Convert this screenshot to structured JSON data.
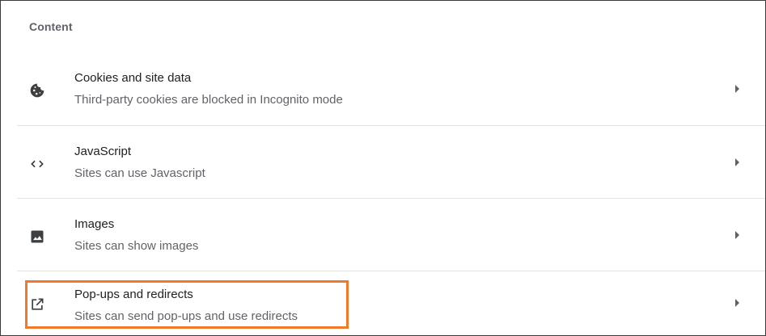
{
  "section": {
    "title": "Content"
  },
  "items": [
    {
      "icon": "cookie-icon",
      "label": "Cookies and site data",
      "description": "Third-party cookies are blocked in Incognito mode"
    },
    {
      "icon": "code-icon",
      "label": "JavaScript",
      "description": "Sites can use Javascript"
    },
    {
      "icon": "image-icon",
      "label": "Images",
      "description": "Sites can show images"
    },
    {
      "icon": "open-in-new-icon",
      "label": "Pop-ups and redirects",
      "description": "Sites can send pop-ups and use redirects"
    }
  ],
  "colors": {
    "highlight": "#f07a2a",
    "primary_text": "#202124",
    "secondary_text": "#5f6368",
    "divider": "#e3e3e3"
  }
}
